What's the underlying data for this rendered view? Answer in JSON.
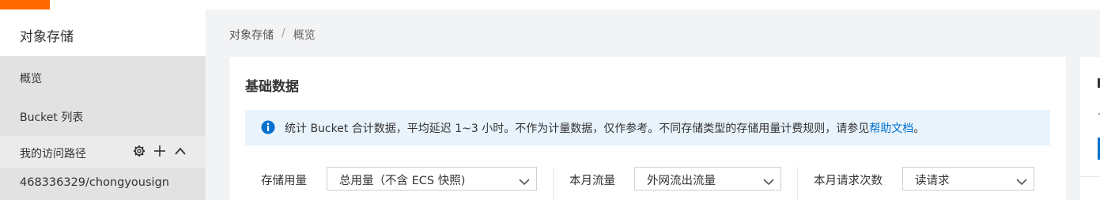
{
  "sidebar": {
    "title": "对象存储",
    "items": [
      {
        "label": "概览"
      },
      {
        "label": "Bucket 列表"
      }
    ],
    "route_section": {
      "title": "我的访问路径",
      "icons": [
        "gear-icon",
        "plus-icon",
        "chevron-up-icon"
      ],
      "paths": [
        "468336329/chongyousign"
      ]
    }
  },
  "breadcrumb": {
    "root": "对象存储",
    "separator": "/",
    "current": "概览"
  },
  "main": {
    "card_title": "基础数据",
    "notice": {
      "icon": "info-icon",
      "text": "统计 Bucket 合计数据，平均延迟 1~3 小时。不作为计量数据，仅作参考。不同存储类型的存储用量计费规则，请参见",
      "link": "帮助文档",
      "suffix": "。"
    },
    "filters": [
      {
        "label": "存储用量",
        "value": "总用量（不含 ECS 快照)"
      },
      {
        "label": "本月流量",
        "value": "外网流出流量"
      },
      {
        "label": "本月请求次数",
        "value": "读请求"
      }
    ]
  },
  "colors": {
    "brand_orange": "#ff6a00",
    "link_blue": "#0070cc",
    "notice_bg": "#e8f3fc",
    "sidebar_active_bg": "#e2e2e2"
  }
}
